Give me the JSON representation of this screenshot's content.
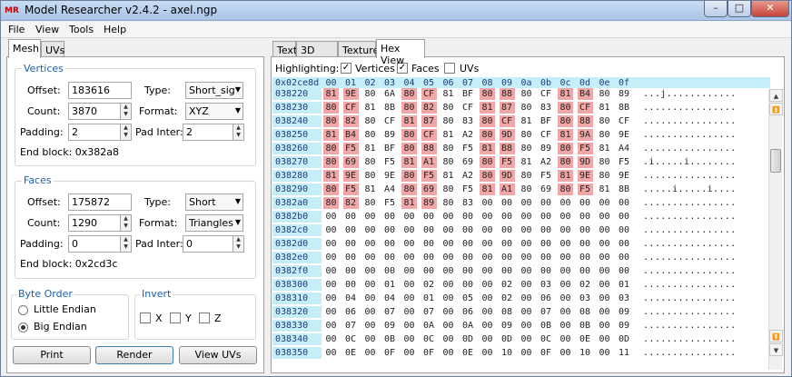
{
  "window": {
    "title": "Model Researcher v2.4.2 - axel.ngp",
    "app_icon": "MR",
    "min": "–",
    "max": "□",
    "close": "✕"
  },
  "menu": [
    "File",
    "View",
    "Tools",
    "Help"
  ],
  "left_tabs": [
    "Mesh",
    "UVs"
  ],
  "vertices": {
    "title": "Vertices",
    "offset_label": "Offset:",
    "offset": "183616",
    "count_label": "Count:",
    "count": "3870",
    "padding_label": "Padding:",
    "padding": "2",
    "type_label": "Type:",
    "type": "Short_sig",
    "format_label": "Format:",
    "format": "XYZ",
    "pad_inter_label": "Pad Inter:",
    "pad_inter": "2",
    "end_block": "End block: 0x382a8"
  },
  "faces": {
    "title": "Faces",
    "offset_label": "Offset:",
    "offset": "175872",
    "count_label": "Count:",
    "count": "1290",
    "padding_label": "Padding:",
    "padding": "0",
    "type_label": "Type:",
    "type": "Short",
    "format_label": "Format:",
    "format": "Triangles",
    "pad_inter_label": "Pad Inter:",
    "pad_inter": "0",
    "end_block": "End block: 0x2cd3c"
  },
  "byte_order": {
    "title": "Byte Order",
    "little": "Little Endian",
    "big": "Big Endian",
    "selected": "big"
  },
  "invert": {
    "title": "Invert",
    "x": "X",
    "y": "Y",
    "z": "Z"
  },
  "buttons": {
    "print": "Print",
    "render": "Render",
    "view_uvs": "View UVs"
  },
  "right_tabs": [
    "Text",
    "3D View",
    "Texture",
    "Hex View"
  ],
  "highlighting": {
    "label": "Highlighting:",
    "vertices": "Vertices",
    "faces": "Faces",
    "uvs": "UVs",
    "check": "✓"
  },
  "hex": {
    "offset_header": "0x02ce8d",
    "columns": [
      "00",
      "01",
      "02",
      "03",
      "04",
      "05",
      "06",
      "07",
      "08",
      "09",
      "0a",
      "0b",
      "0c",
      "0d",
      "0e",
      "0f"
    ],
    "rows": [
      {
        "addr": "038220",
        "bytes": [
          "81",
          "9E",
          "80",
          "6A",
          "80",
          "CF",
          "81",
          "BF",
          "80",
          "88",
          "80",
          "CF",
          "81",
          "B4",
          "80",
          "89"
        ],
        "hl": [
          0,
          1,
          4,
          5,
          8,
          9,
          12,
          13
        ],
        "ascii": "...j............"
      },
      {
        "addr": "038230",
        "bytes": [
          "80",
          "CF",
          "81",
          "8B",
          "80",
          "82",
          "80",
          "CF",
          "81",
          "87",
          "80",
          "83",
          "80",
          "CF",
          "81",
          "8B"
        ],
        "hl": [
          0,
          1,
          4,
          5,
          8,
          9,
          12,
          13
        ],
        "ascii": "................"
      },
      {
        "addr": "038240",
        "bytes": [
          "80",
          "82",
          "80",
          "CF",
          "81",
          "87",
          "80",
          "83",
          "80",
          "CF",
          "81",
          "BF",
          "80",
          "88",
          "80",
          "CF"
        ],
        "hl": [
          0,
          1,
          4,
          5,
          8,
          9,
          12,
          13
        ],
        "ascii": "................"
      },
      {
        "addr": "038250",
        "bytes": [
          "81",
          "B4",
          "80",
          "89",
          "80",
          "CF",
          "81",
          "A2",
          "80",
          "9D",
          "80",
          "CF",
          "81",
          "9A",
          "80",
          "9E"
        ],
        "hl": [
          0,
          1,
          4,
          5,
          8,
          9,
          12,
          13
        ],
        "ascii": "................"
      },
      {
        "addr": "038260",
        "bytes": [
          "80",
          "F5",
          "81",
          "BF",
          "80",
          "88",
          "80",
          "F5",
          "81",
          "B8",
          "80",
          "89",
          "80",
          "F5",
          "81",
          "A4"
        ],
        "hl": [
          0,
          1,
          4,
          5,
          8,
          9,
          12,
          13
        ],
        "ascii": "................"
      },
      {
        "addr": "038270",
        "bytes": [
          "80",
          "69",
          "80",
          "F5",
          "81",
          "A1",
          "80",
          "69",
          "80",
          "F5",
          "81",
          "A2",
          "80",
          "9D",
          "80",
          "F5"
        ],
        "hl": [
          0,
          1,
          4,
          5,
          8,
          9,
          12,
          13
        ],
        "ascii": ".i.....i........"
      },
      {
        "addr": "038280",
        "bytes": [
          "81",
          "9E",
          "80",
          "9E",
          "80",
          "F5",
          "81",
          "A2",
          "80",
          "9D",
          "80",
          "F5",
          "81",
          "9E",
          "80",
          "9E"
        ],
        "hl": [
          0,
          1,
          4,
          5,
          8,
          9,
          12,
          13
        ],
        "ascii": "................"
      },
      {
        "addr": "038290",
        "bytes": [
          "80",
          "F5",
          "81",
          "A4",
          "80",
          "69",
          "80",
          "F5",
          "81",
          "A1",
          "80",
          "69",
          "80",
          "F5",
          "81",
          "8B"
        ],
        "hl": [
          0,
          1,
          4,
          5,
          8,
          9,
          12,
          13
        ],
        "ascii": ".....i.....i...."
      },
      {
        "addr": "0382a0",
        "bytes": [
          "80",
          "82",
          "80",
          "F5",
          "81",
          "89",
          "80",
          "83",
          "00",
          "00",
          "00",
          "00",
          "00",
          "00",
          "00",
          "00"
        ],
        "hl": [
          0,
          1,
          4,
          5
        ],
        "ascii": "................"
      },
      {
        "addr": "0382b0",
        "bytes": [
          "00",
          "00",
          "00",
          "00",
          "00",
          "00",
          "00",
          "00",
          "00",
          "00",
          "00",
          "00",
          "00",
          "00",
          "00",
          "00"
        ],
        "hl": [],
        "ascii": "................"
      },
      {
        "addr": "0382c0",
        "bytes": [
          "00",
          "00",
          "00",
          "00",
          "00",
          "00",
          "00",
          "00",
          "00",
          "00",
          "00",
          "00",
          "00",
          "00",
          "00",
          "00"
        ],
        "hl": [],
        "ascii": "................"
      },
      {
        "addr": "0382d0",
        "bytes": [
          "00",
          "00",
          "00",
          "00",
          "00",
          "00",
          "00",
          "00",
          "00",
          "00",
          "00",
          "00",
          "00",
          "00",
          "00",
          "00"
        ],
        "hl": [],
        "ascii": "................"
      },
      {
        "addr": "0382e0",
        "bytes": [
          "00",
          "00",
          "00",
          "00",
          "00",
          "00",
          "00",
          "00",
          "00",
          "00",
          "00",
          "00",
          "00",
          "00",
          "00",
          "00"
        ],
        "hl": [],
        "ascii": "................"
      },
      {
        "addr": "0382f0",
        "bytes": [
          "00",
          "00",
          "00",
          "00",
          "00",
          "00",
          "00",
          "00",
          "00",
          "00",
          "00",
          "00",
          "00",
          "00",
          "00",
          "00"
        ],
        "hl": [],
        "ascii": "................"
      },
      {
        "addr": "038300",
        "bytes": [
          "00",
          "00",
          "00",
          "01",
          "00",
          "02",
          "00",
          "00",
          "00",
          "02",
          "00",
          "03",
          "00",
          "02",
          "00",
          "01"
        ],
        "hl": [],
        "ascii": "................"
      },
      {
        "addr": "038310",
        "bytes": [
          "00",
          "04",
          "00",
          "04",
          "00",
          "01",
          "00",
          "05",
          "00",
          "02",
          "00",
          "06",
          "00",
          "03",
          "00",
          "03"
        ],
        "hl": [],
        "ascii": "................"
      },
      {
        "addr": "038320",
        "bytes": [
          "00",
          "06",
          "00",
          "07",
          "00",
          "07",
          "00",
          "06",
          "00",
          "08",
          "00",
          "07",
          "00",
          "08",
          "00",
          "09"
        ],
        "hl": [],
        "ascii": "................"
      },
      {
        "addr": "038330",
        "bytes": [
          "00",
          "07",
          "00",
          "09",
          "00",
          "0A",
          "00",
          "0A",
          "00",
          "09",
          "00",
          "0B",
          "00",
          "0B",
          "00",
          "09"
        ],
        "hl": [],
        "ascii": "................"
      },
      {
        "addr": "038340",
        "bytes": [
          "00",
          "0C",
          "00",
          "0B",
          "00",
          "0C",
          "00",
          "0D",
          "00",
          "0D",
          "00",
          "0C",
          "00",
          "0E",
          "00",
          "0D"
        ],
        "hl": [],
        "ascii": "................"
      },
      {
        "addr": "038350",
        "bytes": [
          "00",
          "0E",
          "00",
          "0F",
          "00",
          "0F",
          "00",
          "0E",
          "00",
          "10",
          "00",
          "0F",
          "00",
          "10",
          "00",
          "11"
        ],
        "hl": [],
        "ascii": "................"
      }
    ]
  },
  "scroll": {
    "top": "⏫",
    "up": "▲",
    "down": "▼",
    "bottom": "⏬"
  }
}
